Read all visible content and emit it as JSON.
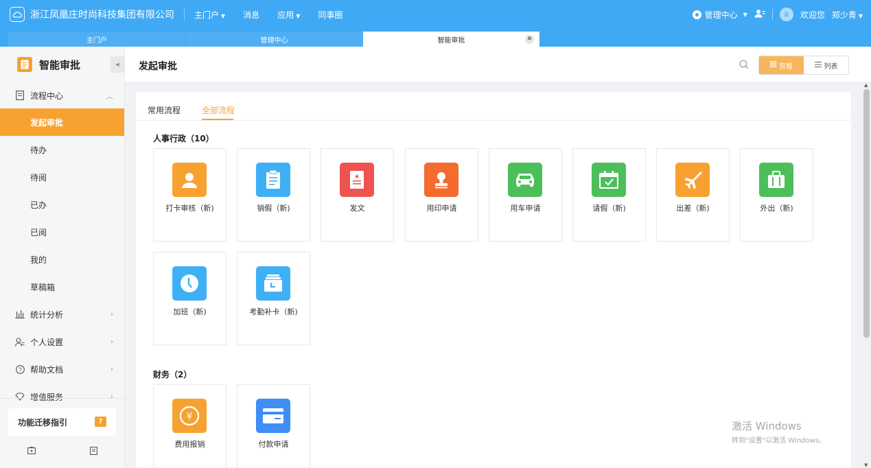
{
  "topbar": {
    "company": "浙江凤凰庄时尚科技集团有限公司",
    "nav": [
      "主门户",
      "消息",
      "应用",
      "同事圈"
    ],
    "admin": "管理中心",
    "avatar_char": "青",
    "welcome": "欢迎您",
    "user": "郑少青"
  },
  "tabs": [
    {
      "label": "主门户"
    },
    {
      "label": "管理中心"
    },
    {
      "label": "智能审批",
      "close": "✕"
    }
  ],
  "sidebar": {
    "title": "智能审批",
    "group1": "流程中心",
    "sub_items": [
      "发起审批",
      "待办",
      "待阅",
      "已办",
      "已阅",
      "我的",
      "草稿箱"
    ],
    "groups": [
      "统计分析",
      "个人设置",
      "帮助文档",
      "增值服务"
    ],
    "guide": "功能迁移指引",
    "guide_badge": "?"
  },
  "main": {
    "title": "发起审批",
    "view_grid": "宫格",
    "view_list": "列表",
    "tabs": [
      "常用流程",
      "全部流程"
    ]
  },
  "sections": [
    {
      "title": "人事行政（10）",
      "items": [
        {
          "label": "打卡审核（新)",
          "color": "#f7a230",
          "icon": "person-icon"
        },
        {
          "label": "销假（新)",
          "color": "#3fb0f5",
          "icon": "clipboard-icon"
        },
        {
          "label": "发文",
          "color": "#ef5350",
          "icon": "document-icon"
        },
        {
          "label": "用印申请",
          "color": "#f46b2e",
          "icon": "stamp-icon"
        },
        {
          "label": "用车申请",
          "color": "#4cbf5a",
          "icon": "car-icon"
        },
        {
          "label": "请假（新)",
          "color": "#4cbf5a",
          "icon": "calendar-icon"
        },
        {
          "label": "出差（新)",
          "color": "#f7a230",
          "icon": "airplane-icon"
        },
        {
          "label": "外出（新)",
          "color": "#4cbf5a",
          "icon": "luggage-icon"
        },
        {
          "label": "加班（新)",
          "color": "#3fb0f5",
          "icon": "clock-icon"
        },
        {
          "label": "考勤补卡（新)",
          "color": "#3fb0f5",
          "icon": "attendance-icon"
        }
      ]
    },
    {
      "title": "财务（2）",
      "items": [
        {
          "label": "费用报销",
          "color": "#f7a230",
          "icon": "yuan-icon"
        },
        {
          "label": "付款申请",
          "color": "#3f8ef5",
          "icon": "card-icon"
        }
      ]
    }
  ],
  "watermark": {
    "line1": "激活 Windows",
    "line2": "转到\"设置\"以激活 Windows。"
  }
}
